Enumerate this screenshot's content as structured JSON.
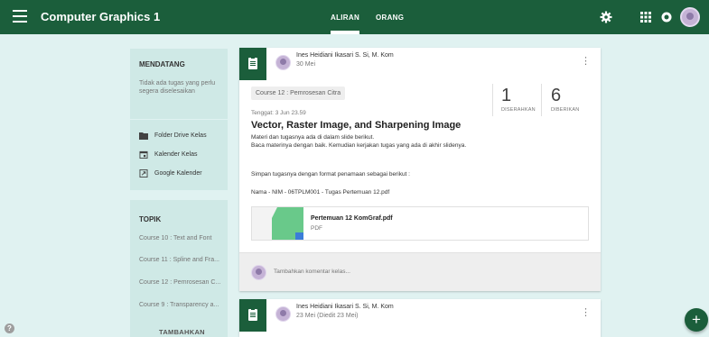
{
  "header": {
    "title": "Computer Graphics 1",
    "tabs": [
      {
        "label": "ALIRAN",
        "active": true
      },
      {
        "label": "ORANG",
        "active": false
      }
    ],
    "brand_color": "#1b5e3b"
  },
  "sidebar": {
    "upcoming": {
      "heading": "MENDATANG",
      "text": "Tidak ada tugas yang perlu segera diselesaikan"
    },
    "links": [
      {
        "label": "Folder Drive Kelas",
        "icon": "folder-icon"
      },
      {
        "label": "Kalender Kelas",
        "icon": "calendar-icon"
      },
      {
        "label": "Google Kalender",
        "icon": "external-link-icon"
      }
    ],
    "topics": {
      "heading": "TOPIK",
      "items": [
        "Course 10 : Text and Font",
        "Course 11 : Spline and Fra...",
        "Course 12 : Pemrosesan C...",
        "Course 9 : Transparency a..."
      ],
      "add_label": "TAMBAHKAN TOPIK"
    }
  },
  "posts": [
    {
      "author": "Ines Heidiani Ikasari S. Si, M. Kom",
      "date": "30 Mei",
      "topic_chip": "Course 12 : Pemrosesan Citra",
      "due": "Tenggat: 3 Jun 23.59",
      "title": "Vector, Raster Image, and Sharpening Image",
      "desc1": "Materi dan tugasnya ada di dalam slide berikut.",
      "desc2": "Baca materinya dengan baik. Kemudian kerjakan tugas yang ada di akhir slidenya.",
      "note1": "Simpan tugasnya dengan format penamaan sebagai berikut :",
      "note2": "Nama - NIM - 06TPLM001 - Tugas Pertemuan 12.pdf",
      "stats": {
        "submitted": "1",
        "submitted_label": "DISERAHKAN",
        "assigned": "6",
        "assigned_label": "DIBERIKAN"
      },
      "attachment": {
        "name": "Pertemuan 12 KomGraf.pdf",
        "type": "PDF"
      },
      "comment_placeholder": "Tambahkan komentar kelas..."
    },
    {
      "author": "Ines Heidiani Ikasari S. Si, M. Kom",
      "date": "23 Mei (Diedit 23 Mei)"
    }
  ],
  "fab": "+",
  "help": "?"
}
